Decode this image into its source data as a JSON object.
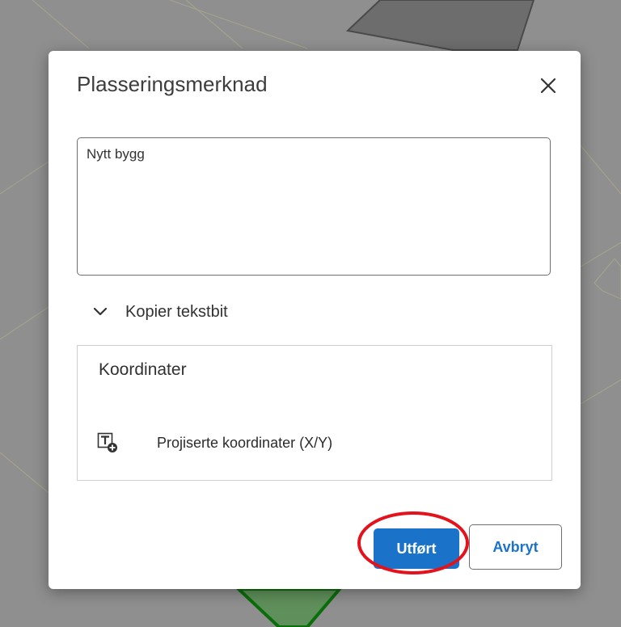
{
  "dialog": {
    "title": "Plasseringsmerknad",
    "close_icon": "close-icon",
    "note": {
      "value": "Nytt bygg",
      "placeholder": ""
    },
    "expander": {
      "label": "Kopier tekstbit",
      "icon": "chevron-down-icon"
    },
    "coordinates": {
      "title": "Koordinater",
      "items": [
        {
          "label": "Projiserte koordinater (X/Y)",
          "icon": "insert-text-icon"
        }
      ]
    },
    "buttons": {
      "done_label": "Utført",
      "cancel_label": "Avbryt"
    }
  },
  "colors": {
    "accent": "#1a73c9",
    "annotation_ring": "#e3121b",
    "backdrop": "#8d8d8d",
    "map_feature_green": "#3d7a3d"
  }
}
